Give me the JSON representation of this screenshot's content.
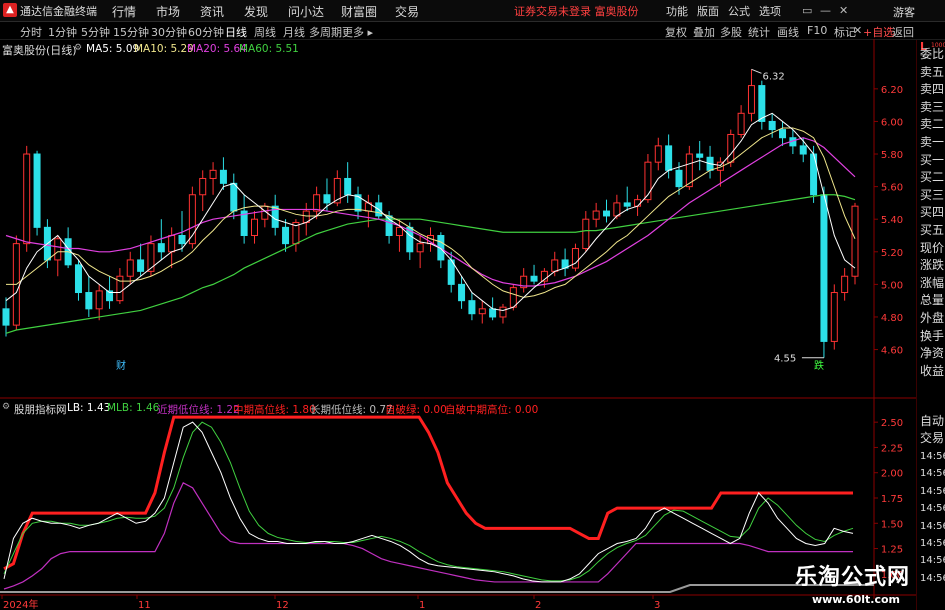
{
  "app": {
    "logo_glyph": "▲",
    "title": "通达信金融终端"
  },
  "menu": [
    "行情",
    "市场",
    "资讯",
    "发现",
    "问小达",
    "财富圈",
    "交易"
  ],
  "notice": "证券交易未登录  富奥股份",
  "right_menu": [
    "功能",
    "版面",
    "公式",
    "选项"
  ],
  "window_buttons": [
    "▭",
    "—",
    "✕"
  ],
  "guest": "游客",
  "timeframes": [
    "分时",
    "1分钟",
    "5分钟",
    "15分钟",
    "30分钟",
    "60分钟",
    "日线",
    "周线",
    "月线",
    "多周期",
    "更多 ▸"
  ],
  "active_timeframe": "日线",
  "toolbar": [
    "复权",
    "叠加",
    "多股",
    "统计",
    "画线",
    "F10",
    "标记",
    "+自选",
    "返回"
  ],
  "close_glyph": "✕",
  "indicator_small": "L",
  "indicator_small_sub": "1000",
  "main": {
    "stock_label": "富奥股份(日线)",
    "ma5": "MA5: 5.09",
    "ma10": "MA10: 5.29",
    "ma20": "MA20: 5.64",
    "ma60": "MA60: 5.51",
    "high_label": "6.32",
    "low_label": "4.55",
    "cai_label": "财",
    "die_label": "跌",
    "price_ticks": [
      "6.20",
      "6.00",
      "5.80",
      "5.60",
      "5.40",
      "5.20",
      "5.00",
      "4.80",
      "4.60"
    ],
    "price_range": [
      4.45,
      6.42
    ]
  },
  "sub": {
    "name": "股朋指标网",
    "lb": "LB: 1.43",
    "mlb": "MLB: 1.46",
    "near_low": "近期低位线: 1.22",
    "mid_high": "中期高位线: 1.80",
    "long_low": "长期低位线: 0.77",
    "auto_break": "自破绿: 0.00",
    "auto_mid": "自破中期高位: 0.00",
    "ticks": [
      "2.50",
      "2.25",
      "2.00",
      "1.75",
      "1.50",
      "1.25",
      "1.00"
    ],
    "range": [
      0.85,
      2.65
    ]
  },
  "xaxis": [
    "2024年",
    "11",
    "12",
    "1",
    "2",
    "3"
  ],
  "side_items": [
    "委比",
    "卖五",
    "卖四",
    "卖三",
    "卖二",
    "卖一",
    "买一",
    "买二",
    "买三",
    "买四",
    "买五",
    "现价",
    "涨跌",
    "涨幅",
    "总量",
    "外盘",
    "换手",
    "净资",
    "收益"
  ],
  "side_items2": [
    "自动",
    "交易"
  ],
  "side_times": [
    "14:56",
    "14:56",
    "14:56",
    "14:56",
    "14:56",
    "14:56",
    "14:56",
    "14:56"
  ],
  "watermark": "乐淘公式网",
  "watermark_url": "www.60lt.com",
  "colors": {
    "up": "#ff3232",
    "down": "#2ce0e8",
    "ma5": "#ffffff",
    "ma10": "#f0e68c",
    "ma20": "#e040e0",
    "ma60": "#40d040",
    "mid_high": "#ff2020",
    "near": "#c030c0"
  },
  "chart_data": {
    "type": "candlestick",
    "ohlc": [
      [
        4.85,
        4.92,
        4.68,
        4.75
      ],
      [
        4.75,
        5.3,
        4.72,
        5.25
      ],
      [
        5.25,
        5.85,
        5.2,
        5.8
      ],
      [
        5.8,
        5.82,
        5.3,
        5.35
      ],
      [
        5.35,
        5.4,
        5.1,
        5.15
      ],
      [
        5.15,
        5.3,
        5.05,
        5.28
      ],
      [
        5.28,
        5.35,
        5.1,
        5.12
      ],
      [
        5.12,
        5.15,
        4.9,
        4.95
      ],
      [
        4.95,
        5.05,
        4.8,
        4.85
      ],
      [
        4.85,
        5.0,
        4.78,
        4.96
      ],
      [
        4.96,
        5.05,
        4.85,
        4.9
      ],
      [
        4.9,
        5.1,
        4.88,
        5.05
      ],
      [
        5.05,
        5.2,
        5.0,
        5.15
      ],
      [
        5.15,
        5.25,
        5.05,
        5.08
      ],
      [
        5.08,
        5.3,
        5.05,
        5.25
      ],
      [
        5.25,
        5.4,
        5.15,
        5.2
      ],
      [
        5.2,
        5.35,
        5.1,
        5.3
      ],
      [
        5.3,
        5.45,
        5.2,
        5.25
      ],
      [
        5.25,
        5.6,
        5.22,
        5.55
      ],
      [
        5.55,
        5.7,
        5.45,
        5.65
      ],
      [
        5.65,
        5.75,
        5.55,
        5.7
      ],
      [
        5.7,
        5.78,
        5.58,
        5.62
      ],
      [
        5.62,
        5.68,
        5.4,
        5.45
      ],
      [
        5.45,
        5.55,
        5.25,
        5.3
      ],
      [
        5.3,
        5.45,
        5.25,
        5.4
      ],
      [
        5.4,
        5.5,
        5.35,
        5.48
      ],
      [
        5.48,
        5.55,
        5.3,
        5.35
      ],
      [
        5.35,
        5.4,
        5.2,
        5.25
      ],
      [
        5.25,
        5.4,
        5.2,
        5.38
      ],
      [
        5.38,
        5.5,
        5.3,
        5.45
      ],
      [
        5.45,
        5.6,
        5.4,
        5.55
      ],
      [
        5.55,
        5.65,
        5.45,
        5.5
      ],
      [
        5.5,
        5.7,
        5.48,
        5.65
      ],
      [
        5.65,
        5.75,
        5.5,
        5.55
      ],
      [
        5.55,
        5.6,
        5.4,
        5.45
      ],
      [
        5.45,
        5.55,
        5.35,
        5.5
      ],
      [
        5.5,
        5.55,
        5.4,
        5.42
      ],
      [
        5.42,
        5.45,
        5.25,
        5.3
      ],
      [
        5.3,
        5.4,
        5.2,
        5.35
      ],
      [
        5.35,
        5.38,
        5.15,
        5.2
      ],
      [
        5.2,
        5.3,
        5.1,
        5.25
      ],
      [
        5.25,
        5.35,
        5.2,
        5.3
      ],
      [
        5.3,
        5.32,
        5.1,
        5.15
      ],
      [
        5.15,
        5.2,
        4.95,
        5.0
      ],
      [
        5.0,
        5.05,
        4.85,
        4.9
      ],
      [
        4.9,
        4.95,
        4.78,
        4.82
      ],
      [
        4.82,
        4.9,
        4.76,
        4.85
      ],
      [
        4.85,
        4.92,
        4.78,
        4.8
      ],
      [
        4.8,
        4.88,
        4.76,
        4.86
      ],
      [
        4.86,
        5.0,
        4.84,
        4.98
      ],
      [
        4.98,
        5.1,
        4.95,
        5.05
      ],
      [
        5.05,
        5.12,
        5.0,
        5.02
      ],
      [
        5.02,
        5.1,
        4.98,
        5.08
      ],
      [
        5.08,
        5.2,
        5.05,
        5.15
      ],
      [
        5.15,
        5.22,
        5.05,
        5.1
      ],
      [
        5.1,
        5.25,
        5.08,
        5.22
      ],
      [
        5.22,
        5.45,
        5.2,
        5.4
      ],
      [
        5.4,
        5.5,
        5.35,
        5.45
      ],
      [
        5.45,
        5.52,
        5.38,
        5.42
      ],
      [
        5.42,
        5.55,
        5.4,
        5.5
      ],
      [
        5.5,
        5.6,
        5.45,
        5.48
      ],
      [
        5.48,
        5.55,
        5.42,
        5.52
      ],
      [
        5.52,
        5.8,
        5.5,
        5.75
      ],
      [
        5.75,
        5.9,
        5.7,
        5.85
      ],
      [
        5.85,
        5.92,
        5.65,
        5.7
      ],
      [
        5.7,
        5.75,
        5.55,
        5.6
      ],
      [
        5.6,
        5.85,
        5.58,
        5.8
      ],
      [
        5.8,
        5.88,
        5.7,
        5.78
      ],
      [
        5.78,
        5.85,
        5.65,
        5.7
      ],
      [
        5.7,
        5.78,
        5.6,
        5.75
      ],
      [
        5.75,
        5.95,
        5.72,
        5.92
      ],
      [
        5.92,
        6.1,
        5.9,
        6.05
      ],
      [
        6.05,
        6.32,
        6.0,
        6.22
      ],
      [
        6.22,
        6.25,
        5.95,
        6.0
      ],
      [
        6.0,
        6.05,
        5.9,
        5.95
      ],
      [
        5.95,
        6.0,
        5.85,
        5.9
      ],
      [
        5.9,
        5.95,
        5.8,
        5.85
      ],
      [
        5.85,
        5.9,
        5.75,
        5.8
      ],
      [
        5.8,
        5.85,
        5.5,
        5.55
      ],
      [
        5.55,
        5.6,
        4.55,
        4.65
      ],
      [
        4.65,
        5.0,
        4.6,
        4.95
      ],
      [
        4.95,
        5.1,
        4.9,
        5.05
      ],
      [
        5.05,
        5.5,
        5.0,
        5.48
      ]
    ],
    "ma5": [
      4.9,
      4.95,
      5.1,
      5.2,
      5.25,
      5.3,
      5.22,
      5.15,
      5.05,
      5.0,
      4.95,
      4.95,
      5.0,
      5.05,
      5.1,
      5.15,
      5.2,
      5.22,
      5.3,
      5.4,
      5.5,
      5.6,
      5.62,
      5.55,
      5.5,
      5.45,
      5.4,
      5.38,
      5.36,
      5.38,
      5.42,
      5.48,
      5.52,
      5.55,
      5.54,
      5.5,
      5.46,
      5.4,
      5.36,
      5.3,
      5.26,
      5.25,
      5.22,
      5.15,
      5.05,
      4.95,
      4.9,
      4.85,
      4.84,
      4.86,
      4.92,
      4.98,
      5.03,
      5.08,
      5.1,
      5.13,
      5.2,
      5.28,
      5.35,
      5.42,
      5.46,
      5.48,
      5.55,
      5.65,
      5.7,
      5.72,
      5.74,
      5.76,
      5.74,
      5.73,
      5.8,
      5.88,
      5.98,
      6.02,
      6.05,
      6.0,
      5.95,
      5.88,
      5.8,
      5.55,
      5.3,
      5.15,
      5.1
    ],
    "ma10": [
      5.0,
      5.0,
      5.05,
      5.1,
      5.15,
      5.2,
      5.2,
      5.18,
      5.12,
      5.08,
      5.05,
      5.02,
      5.02,
      5.03,
      5.05,
      5.08,
      5.12,
      5.15,
      5.2,
      5.27,
      5.33,
      5.4,
      5.45,
      5.47,
      5.48,
      5.48,
      5.47,
      5.45,
      5.43,
      5.42,
      5.42,
      5.43,
      5.45,
      5.46,
      5.46,
      5.45,
      5.44,
      5.42,
      5.39,
      5.35,
      5.31,
      5.28,
      5.26,
      5.22,
      5.17,
      5.1,
      5.05,
      5.0,
      4.96,
      4.94,
      4.92,
      4.93,
      4.95,
      4.98,
      5.0,
      5.05,
      5.1,
      5.15,
      5.2,
      5.26,
      5.3,
      5.36,
      5.42,
      5.48,
      5.54,
      5.58,
      5.62,
      5.66,
      5.7,
      5.72,
      5.75,
      5.8,
      5.85,
      5.9,
      5.93,
      5.96,
      5.96,
      5.94,
      5.9,
      5.78,
      5.6,
      5.42,
      5.28
    ],
    "ma20": [
      5.3,
      5.28,
      5.26,
      5.25,
      5.24,
      5.23,
      5.22,
      5.22,
      5.21,
      5.2,
      5.2,
      5.21,
      5.22,
      5.24,
      5.26,
      5.28,
      5.3,
      5.32,
      5.35,
      5.38,
      5.4,
      5.41,
      5.42,
      5.43,
      5.44,
      5.45,
      5.46,
      5.46,
      5.46,
      5.46,
      5.46,
      5.45,
      5.44,
      5.43,
      5.42,
      5.41,
      5.4,
      5.38,
      5.36,
      5.33,
      5.3,
      5.26,
      5.22,
      5.18,
      5.14,
      5.1,
      5.06,
      5.03,
      5.01,
      5.0,
      4.99,
      4.99,
      5.0,
      5.01,
      5.03,
      5.05,
      5.08,
      5.11,
      5.14,
      5.18,
      5.22,
      5.26,
      5.3,
      5.35,
      5.4,
      5.45,
      5.5,
      5.54,
      5.58,
      5.62,
      5.66,
      5.7,
      5.74,
      5.78,
      5.82,
      5.86,
      5.88,
      5.9,
      5.88,
      5.84,
      5.78,
      5.72,
      5.66
    ],
    "ma60": [
      4.7,
      4.72,
      4.73,
      4.74,
      4.75,
      4.76,
      4.77,
      4.78,
      4.79,
      4.8,
      4.81,
      4.82,
      4.83,
      4.84,
      4.86,
      4.88,
      4.9,
      4.92,
      4.95,
      4.98,
      5.0,
      5.03,
      5.06,
      5.1,
      5.13,
      5.16,
      5.19,
      5.22,
      5.25,
      5.28,
      5.31,
      5.33,
      5.35,
      5.37,
      5.38,
      5.39,
      5.4,
      5.4,
      5.4,
      5.4,
      5.4,
      5.39,
      5.38,
      5.37,
      5.36,
      5.35,
      5.34,
      5.33,
      5.32,
      5.32,
      5.32,
      5.32,
      5.32,
      5.32,
      5.32,
      5.32,
      5.33,
      5.33,
      5.34,
      5.35,
      5.36,
      5.37,
      5.38,
      5.39,
      5.4,
      5.41,
      5.42,
      5.43,
      5.44,
      5.45,
      5.46,
      5.47,
      5.48,
      5.49,
      5.5,
      5.51,
      5.52,
      5.53,
      5.54,
      5.55,
      5.55,
      5.54,
      5.52
    ],
    "sub_lb": [
      0.95,
      1.35,
      1.5,
      1.55,
      1.52,
      1.5,
      1.5,
      1.48,
      1.45,
      1.48,
      1.5,
      1.55,
      1.6,
      1.55,
      1.5,
      1.52,
      1.6,
      1.75,
      2.1,
      2.45,
      2.5,
      2.4,
      2.2,
      2.0,
      1.75,
      1.55,
      1.4,
      1.35,
      1.32,
      1.32,
      1.3,
      1.3,
      1.3,
      1.32,
      1.32,
      1.3,
      1.3,
      1.32,
      1.35,
      1.38,
      1.35,
      1.32,
      1.28,
      1.22,
      1.15,
      1.1,
      1.08,
      1.07,
      1.06,
      1.05,
      1.04,
      1.03,
      1.02,
      1.0,
      0.98,
      0.95,
      0.93,
      0.92,
      0.92,
      0.92,
      0.95,
      1.0,
      1.1,
      1.2,
      1.25,
      1.3,
      1.32,
      1.35,
      1.45,
      1.6,
      1.65,
      1.6,
      1.55,
      1.5,
      1.45,
      1.4,
      1.35,
      1.3,
      1.35,
      1.6,
      1.8,
      1.7,
      1.55,
      1.45,
      1.35,
      1.3,
      1.28,
      1.3,
      1.45,
      1.42,
      1.4
    ],
    "sub_mlb": [
      1.0,
      1.2,
      1.4,
      1.5,
      1.52,
      1.52,
      1.5,
      1.5,
      1.48,
      1.48,
      1.5,
      1.52,
      1.55,
      1.56,
      1.55,
      1.55,
      1.57,
      1.65,
      1.85,
      2.15,
      2.4,
      2.5,
      2.45,
      2.3,
      2.1,
      1.85,
      1.62,
      1.48,
      1.4,
      1.36,
      1.34,
      1.32,
      1.31,
      1.31,
      1.32,
      1.32,
      1.31,
      1.31,
      1.33,
      1.35,
      1.37,
      1.35,
      1.32,
      1.28,
      1.22,
      1.17,
      1.12,
      1.09,
      1.07,
      1.06,
      1.05,
      1.04,
      1.03,
      1.02,
      1.0,
      0.98,
      0.96,
      0.94,
      0.93,
      0.93,
      0.94,
      0.97,
      1.03,
      1.12,
      1.2,
      1.26,
      1.3,
      1.33,
      1.38,
      1.48,
      1.58,
      1.63,
      1.62,
      1.57,
      1.52,
      1.47,
      1.42,
      1.37,
      1.36,
      1.45,
      1.65,
      1.75,
      1.68,
      1.58,
      1.48,
      1.4,
      1.34,
      1.32,
      1.38,
      1.42,
      1.45
    ],
    "sub_mid": [
      1.05,
      1.1,
      1.4,
      1.6,
      1.6,
      1.6,
      1.6,
      1.6,
      1.6,
      1.6,
      1.6,
      1.6,
      1.6,
      1.6,
      1.6,
      1.6,
      1.8,
      2.2,
      2.55,
      2.55,
      2.55,
      2.55,
      2.55,
      2.55,
      2.55,
      2.55,
      2.55,
      2.55,
      2.55,
      2.55,
      2.55,
      2.55,
      2.55,
      2.55,
      2.55,
      2.55,
      2.55,
      2.55,
      2.55,
      2.55,
      2.55,
      2.55,
      2.55,
      2.55,
      2.55,
      2.4,
      2.2,
      1.9,
      1.75,
      1.6,
      1.5,
      1.45,
      1.45,
      1.45,
      1.45,
      1.45,
      1.45,
      1.45,
      1.45,
      1.45,
      1.45,
      1.4,
      1.35,
      1.35,
      1.6,
      1.65,
      1.65,
      1.65,
      1.65,
      1.65,
      1.65,
      1.65,
      1.65,
      1.65,
      1.65,
      1.65,
      1.8,
      1.8,
      1.8,
      1.8,
      1.8,
      1.8,
      1.8,
      1.8,
      1.8,
      1.8,
      1.8,
      1.8,
      1.8,
      1.8,
      1.8
    ],
    "sub_near": [
      0.85,
      0.88,
      0.92,
      0.98,
      1.05,
      1.15,
      1.2,
      1.22,
      1.22,
      1.22,
      1.22,
      1.22,
      1.22,
      1.22,
      1.22,
      1.22,
      1.22,
      1.4,
      1.7,
      1.9,
      1.85,
      1.7,
      1.55,
      1.4,
      1.32,
      1.3,
      1.3,
      1.3,
      1.3,
      1.3,
      1.3,
      1.3,
      1.3,
      1.3,
      1.3,
      1.3,
      1.3,
      1.28,
      1.25,
      1.2,
      1.15,
      1.12,
      1.1,
      1.08,
      1.06,
      1.04,
      1.02,
      1.0,
      0.98,
      0.96,
      0.94,
      0.93,
      0.92,
      0.92,
      0.92,
      0.92,
      0.92,
      0.92,
      0.92,
      0.92,
      0.92,
      0.92,
      0.92,
      0.92,
      1.0,
      1.1,
      1.2,
      1.3,
      1.3,
      1.3,
      1.3,
      1.3,
      1.3,
      1.3,
      1.3,
      1.3,
      1.3,
      1.3,
      1.3,
      1.28,
      1.25,
      1.22,
      1.22,
      1.22,
      1.22,
      1.22,
      1.22,
      1.22,
      1.22,
      1.22,
      1.22
    ]
  }
}
